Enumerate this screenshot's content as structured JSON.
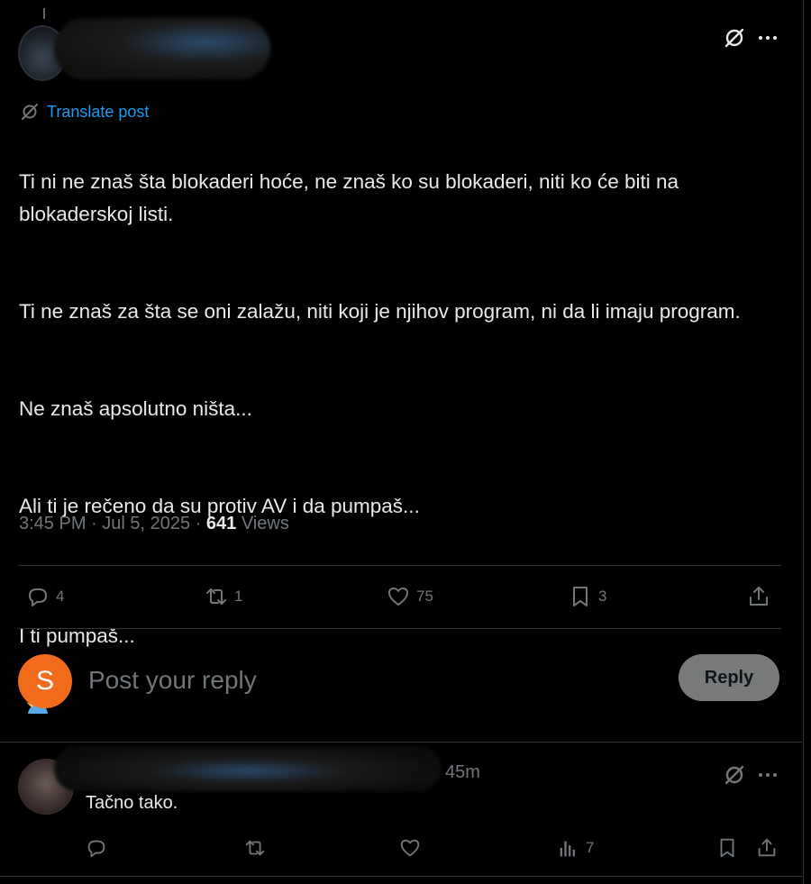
{
  "post": {
    "translate_label": "Translate post",
    "paragraphs": [
      "Ti ni ne znaš šta blokaderi hoće, ne znaš ko su blokaderi, niti ko će biti na blokaderskoj listi.",
      "Ti ne znaš za šta se oni zalažu, niti koji je njihov program, ni da li imaju program.",
      "Ne znaš apsolutno ništa...",
      "Ali ti je rečeno da su protiv AV i da pumpaš...",
      "I ti pumpaš..."
    ],
    "emoji_name": "man-shrugging-emoji",
    "time": "3:45 PM",
    "date": "Jul 5, 2025",
    "views_count": "641",
    "views_label": "Views",
    "actions": {
      "replies": "4",
      "reposts": "1",
      "likes": "75",
      "bookmarks": "3"
    }
  },
  "compose": {
    "avatar_letter": "S",
    "placeholder": "Post your reply",
    "reply_button": "Reply"
  },
  "reply": {
    "time_ago": "45m",
    "text": "Tačno tako.",
    "views": "7"
  },
  "colors": {
    "background": "#000000",
    "text": "#e7e9ea",
    "muted": "#71767b",
    "link": "#1d9bf0",
    "avatar_s": "#f26b1d",
    "reply_button_bg": "#787a7a"
  }
}
